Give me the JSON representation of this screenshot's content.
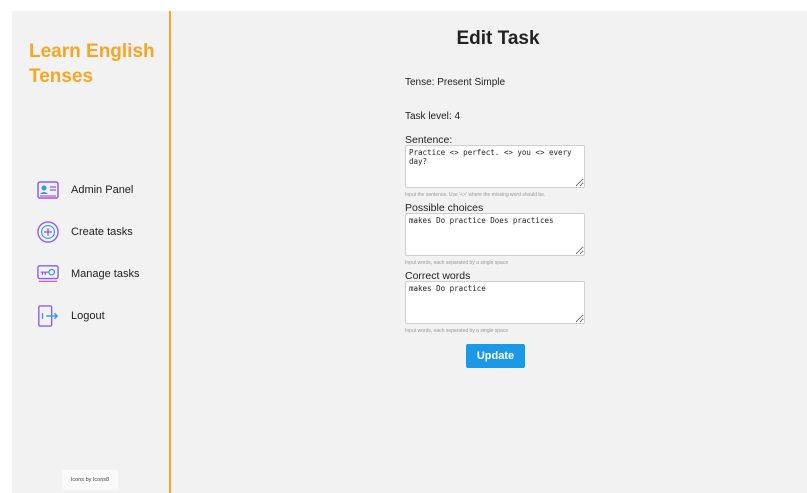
{
  "app": {
    "brand": "Learn English Tenses"
  },
  "sidebar": {
    "items": [
      {
        "label": "Admin Panel",
        "icon": "admin-panel-icon"
      },
      {
        "label": "Create tasks",
        "icon": "add-circle-icon"
      },
      {
        "label": "Manage tasks",
        "icon": "key-card-icon"
      },
      {
        "label": "Logout",
        "icon": "logout-door-icon"
      }
    ],
    "credit": "Icons by Icons8"
  },
  "main": {
    "title": "Edit Task",
    "tense": "Tense: Present Simple",
    "task_level": "Task level: 4",
    "sentence": {
      "label": "Sentence:",
      "value": "Practice <> perfect. <> you <> every day?",
      "hint": "Input the sentence. Use '<>' where the missing word should be."
    },
    "choices": {
      "label": "Possible choices",
      "value": "makes Do practice Does practices",
      "hint": "Input words, each separated by a single space"
    },
    "correct": {
      "label": "Correct words",
      "value": "makes Do practice",
      "hint": "Input words, each separated by a single space"
    },
    "update_label": "Update"
  },
  "colors": {
    "accent": "#f5a623",
    "button": "#1a9ae6",
    "icon_purple": "#8b5cf6"
  }
}
